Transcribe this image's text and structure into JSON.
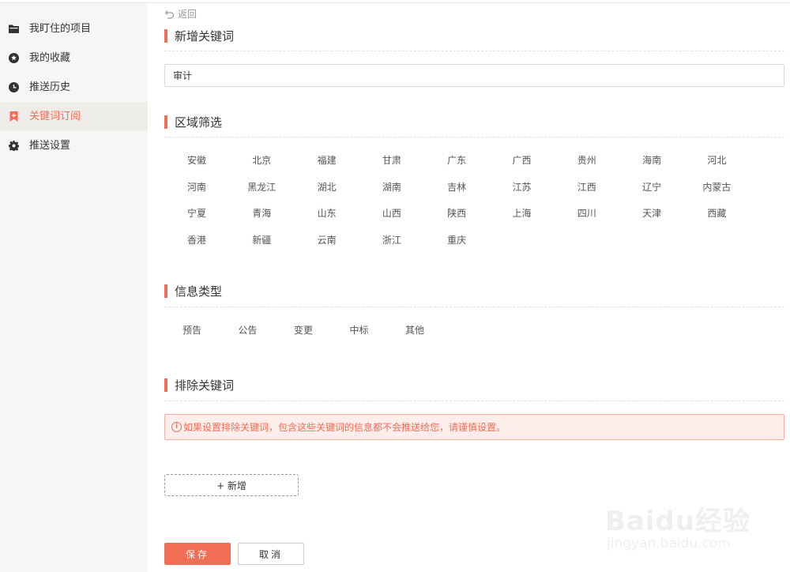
{
  "sidebar": {
    "items": [
      {
        "label": "我盯住的项目",
        "icon": "folder-icon"
      },
      {
        "label": "我的收藏",
        "icon": "star-circle-icon"
      },
      {
        "label": "推送历史",
        "icon": "clock-icon"
      },
      {
        "label": "关键词订阅",
        "icon": "bookmark-plus-icon",
        "active": true
      },
      {
        "label": "推送设置",
        "icon": "gear-icon"
      }
    ]
  },
  "back_label": "返回",
  "sections": {
    "add_keyword": "新增关键词",
    "region": "区域筛选",
    "info_type": "信息类型",
    "exclude": "排除关键词"
  },
  "keyword_input": {
    "value": "审计"
  },
  "regions": [
    "安徽",
    "北京",
    "福建",
    "甘肃",
    "广东",
    "广西",
    "贵州",
    "海南",
    "河北",
    "河南",
    "黑龙江",
    "湖北",
    "湖南",
    "吉林",
    "江苏",
    "江西",
    "辽宁",
    "内蒙古",
    "宁夏",
    "青海",
    "山东",
    "山西",
    "陕西",
    "上海",
    "四川",
    "天津",
    "西藏",
    "香港",
    "新疆",
    "云南",
    "浙江",
    "重庆"
  ],
  "info_types": [
    "预告",
    "公告",
    "变更",
    "中标",
    "其他"
  ],
  "alert_text": "如果设置排除关键词，包含这些关键词的信息都不会推送给您，请谨慎设置。",
  "add_button": "+ 新增",
  "save_button": "保存",
  "cancel_button": "取消",
  "watermark": {
    "logo": "Baidu经验",
    "url": "jingyan.baidu.com"
  },
  "colors": {
    "accent": "#f26d55",
    "sidebar_bg": "#f7f6f4"
  }
}
